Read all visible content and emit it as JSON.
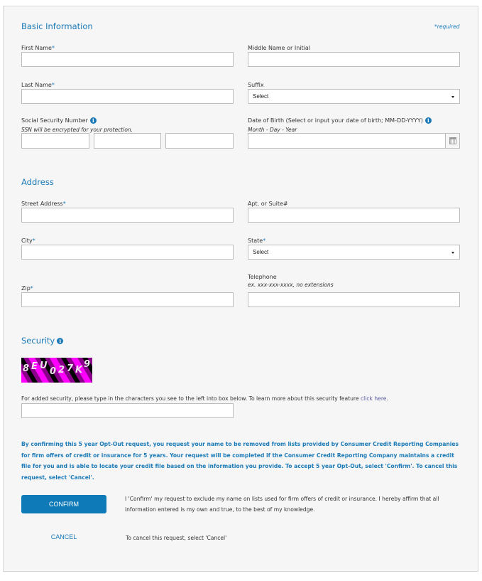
{
  "colors": {
    "accent": "#1a7ab8",
    "button": "#0f7ab8",
    "panel_bg": "#f6f6f6",
    "link": "#5a5aa0"
  },
  "basic_info": {
    "heading": "Basic Information",
    "required_note": "*required",
    "first_name": {
      "label": "First Name",
      "required_mark": "*",
      "value": ""
    },
    "middle_name": {
      "label": "Middle Name or Initial",
      "value": ""
    },
    "last_name": {
      "label": "Last Name",
      "required_mark": "*",
      "value": ""
    },
    "suffix": {
      "label": "Suffix",
      "selected": "Select"
    },
    "ssn": {
      "label": "Social Security Number",
      "hint": "SSN will be encrypted for your protection.",
      "info_icon": "info-icon",
      "parts": [
        "",
        "",
        ""
      ]
    },
    "dob": {
      "label": "Date of Birth (Select or input your date of birth; MM-DD-YYYY)",
      "hint": "Month - Day - Year",
      "info_icon": "info-icon",
      "calendar_icon": "calendar-icon",
      "value": ""
    }
  },
  "address": {
    "heading": "Address",
    "street": {
      "label": "Street Address",
      "required_mark": "*",
      "value": ""
    },
    "apt": {
      "label": "Apt. or Suite#",
      "value": ""
    },
    "city": {
      "label": "City",
      "required_mark": "*",
      "value": ""
    },
    "state": {
      "label": "State",
      "required_mark": "*",
      "selected": "Select"
    },
    "zip": {
      "label": "Zip",
      "required_mark": "*",
      "value": ""
    },
    "telephone": {
      "label": "Telephone",
      "hint": "ex. xxx-xxx-xxxx, no extensions",
      "value": ""
    }
  },
  "security": {
    "heading": "Security",
    "info_icon": "info-icon",
    "captcha_chars": [
      "8",
      "E",
      "U",
      "0",
      "2",
      "7",
      "K",
      "9"
    ],
    "instruction": "For added security, please type in the characters you see to the left into box below. To learn more about this security feature ",
    "link_text": "click here",
    "instruction_end": ".",
    "value": ""
  },
  "notice": "By confirming this 5 year Opt-Out request, you request your name to be removed from lists provided by Consumer Credit Reporting Companies for firm offers of credit or insurance for 5 years. Your request will be completed if the Consumer Credit Reporting Company maintains a credit file for you and is able to locate your credit file based on the information you provide. To accept 5 year Opt-Out, select 'Confirm'. To cancel this request, select 'Cancel'.",
  "actions": {
    "confirm_label": "CONFIRM",
    "confirm_text": "I 'Confirm' my request to exclude my name on lists used for firm offers of credit or insurance. I hereby affirm that all information entered is my own and true, to the best of my knowledge.",
    "cancel_label": "CANCEL",
    "cancel_text": "To cancel this request, select 'Cancel'"
  }
}
